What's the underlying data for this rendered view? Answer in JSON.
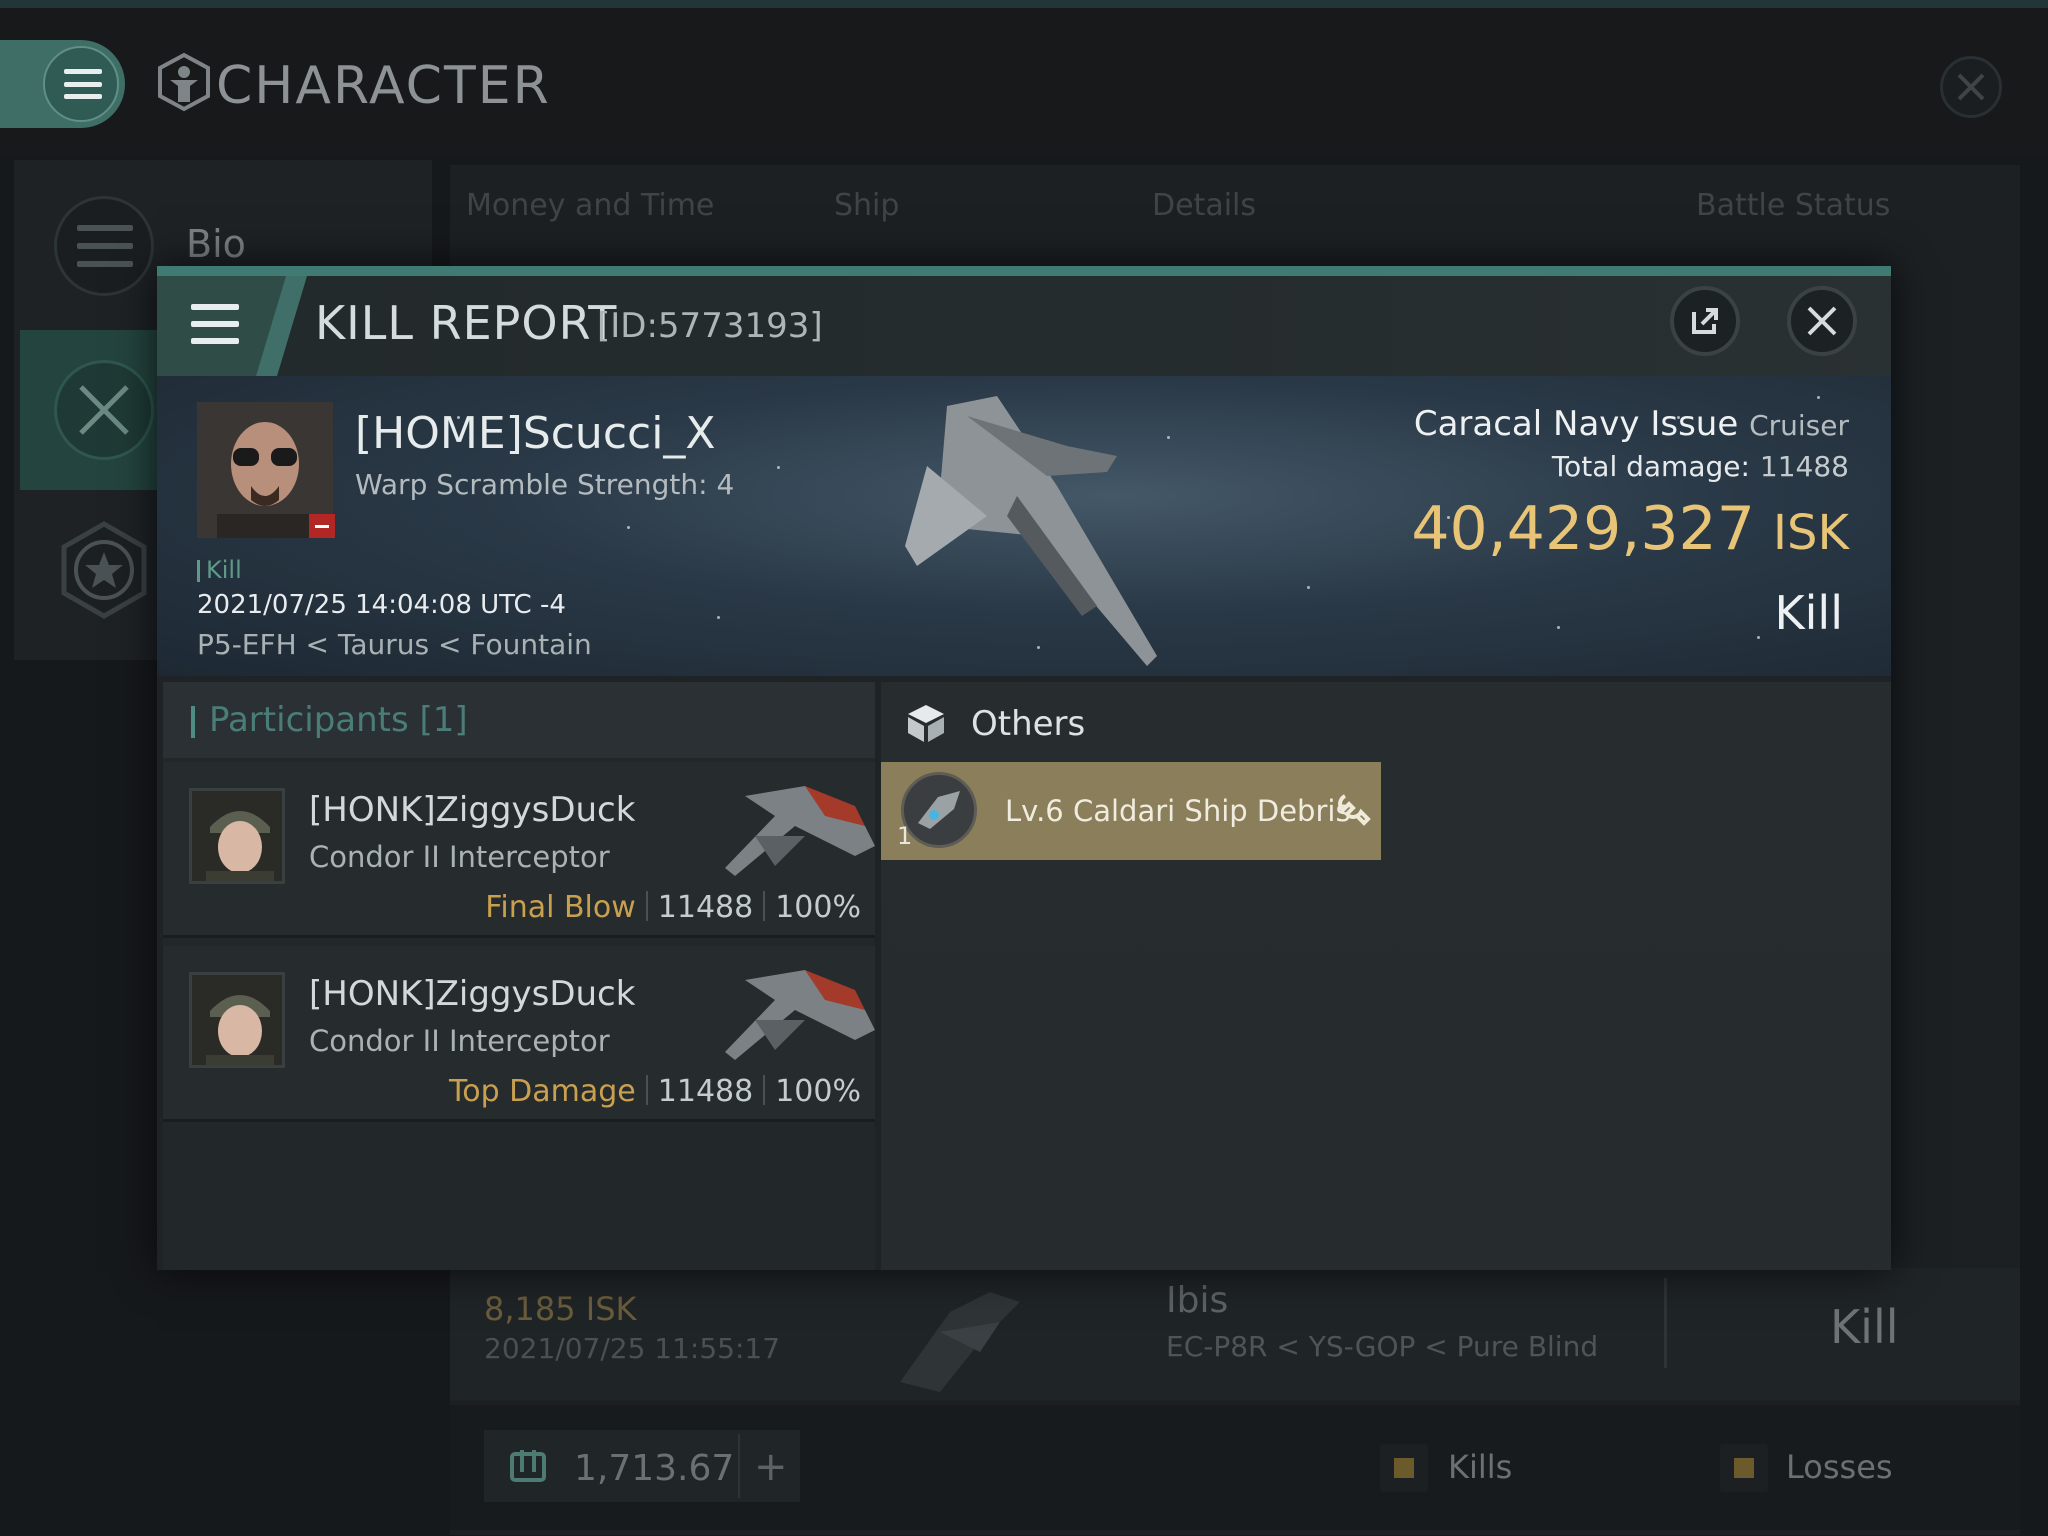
{
  "background": {
    "title": "CHARACTER",
    "sidebar": {
      "bio_label": "Bio"
    },
    "tabs": [
      "Money and Time",
      "Ship",
      "Details",
      "Battle Status"
    ],
    "list_row": {
      "isk": "8,185  ISK",
      "date": "2021/07/25  11:55:17",
      "ship": "Ibis",
      "location": "EC-P8R < YS-GOP < Pure Blind",
      "result": "Kill"
    },
    "footer": {
      "wallet_value": "1,713.67",
      "legend": [
        {
          "label": "Kills",
          "color": "#6a5a2c"
        },
        {
          "label": "Losses",
          "color": "#6a5a2c"
        }
      ]
    }
  },
  "kill_report": {
    "title": "KILL REPORT",
    "id": "[ID:5773193]",
    "victim": {
      "name": "[HOME]Scucci_X",
      "subtitle": "Warp Scramble Strength: 4",
      "kill_tag": "Kill",
      "datetime": "2021/07/25 14:04:08 UTC -4",
      "location": "P5-EFH < Taurus < Fountain"
    },
    "ship": {
      "name": "Caracal Navy Issue",
      "class": "Cruiser",
      "total_damage_label": "Total damage:",
      "total_damage": "11488",
      "value": "40,429,327",
      "currency": "ISK",
      "result": "Kill"
    },
    "participants": {
      "title": "Participants [1]",
      "rows": [
        {
          "name": "[HONK]ZiggysDuck",
          "ship": "Condor II Interceptor",
          "tag": "Final Blow",
          "damage": "11488",
          "percent": "100%"
        },
        {
          "name": "[HONK]ZiggysDuck",
          "ship": "Condor II Interceptor",
          "tag": "Top Damage",
          "damage": "11488",
          "percent": "100%"
        }
      ]
    },
    "others": {
      "title": "Others",
      "items": [
        {
          "name": "Lv.6 Caldari Ship Debris",
          "quantity": "1",
          "icon": "wrench-icon"
        }
      ]
    }
  },
  "colors": {
    "accent": "#3f7b72",
    "isk_gold": "#e8c477",
    "tag_gold": "#c9a04e",
    "loot_bg": "#8b7e5a"
  }
}
